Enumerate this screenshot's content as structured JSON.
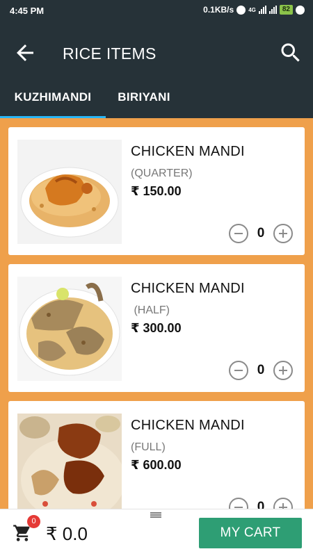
{
  "status_bar": {
    "time": "4:45 PM",
    "network_speed": "0.1KB/s",
    "network_type": "4G",
    "battery": "82"
  },
  "appbar": {
    "title": "RICE ITEMS",
    "back_icon": "arrow-left-icon",
    "search_icon": "search-icon"
  },
  "tabs": [
    {
      "label": "KUZHIMANDI",
      "selected": true
    },
    {
      "label": "BIRIYANI",
      "selected": false
    }
  ],
  "items": [
    {
      "name": "CHICKEN MANDI",
      "size": "(QUARTER)",
      "price": "₹ 150.00",
      "quantity": "0"
    },
    {
      "name": "CHICKEN MANDI",
      "size": " (HALF)",
      "price": "₹ 300.00",
      "quantity": "0"
    },
    {
      "name": "CHICKEN MANDI",
      "size": "(FULL)",
      "price": "₹ 600.00",
      "quantity": "0"
    }
  ],
  "bottom_bar": {
    "cart_badge": "0",
    "total": "₹ 0.0",
    "my_cart_label": "MY CART"
  },
  "colors": {
    "app_bar": "#263238",
    "tab_indicator": "#29b6f6",
    "list_background": "#efa04b",
    "cart_button": "#2e9e74",
    "badge": "#e53935"
  }
}
